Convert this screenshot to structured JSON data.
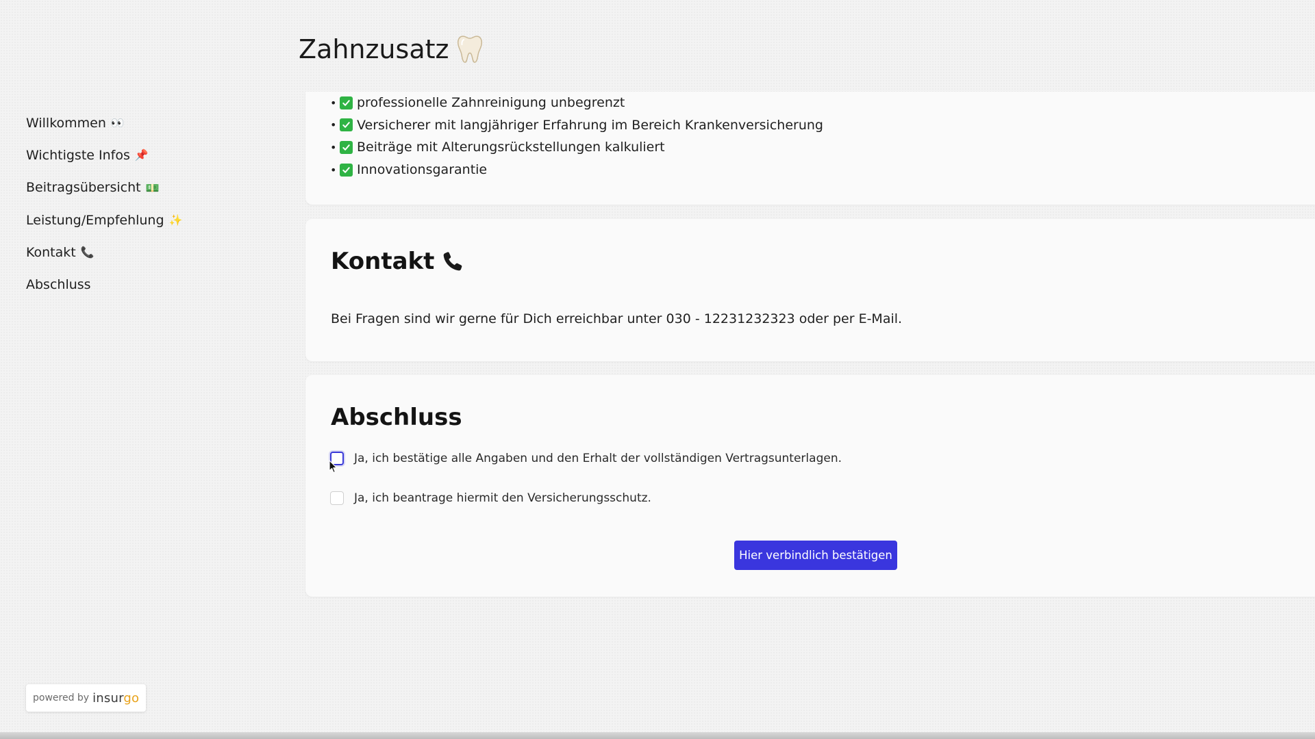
{
  "page_title": "Zahnzusatz",
  "page_title_icon": "tooth-icon",
  "sidebar": {
    "items": [
      {
        "label": "Willkommen",
        "emoji": "👀"
      },
      {
        "label": "Wichtigste Infos",
        "emoji": "📌"
      },
      {
        "label": "Beitragsübersicht",
        "emoji": "💵"
      },
      {
        "label": "Leistung/Empfehlung",
        "emoji": "✨"
      },
      {
        "label": "Kontakt",
        "emoji": "📞"
      },
      {
        "label": "Abschluss",
        "emoji": ""
      }
    ]
  },
  "benefits": {
    "items": [
      "professionelle Zahnreinigung unbegrenzt",
      "Versicherer mit langjähriger Erfahrung im Bereich Krankenversicherung",
      "Beiträge mit Alterungsrückstellungen kalkuliert",
      "Innovationsgarantie"
    ]
  },
  "kontakt": {
    "title": "Kontakt",
    "title_icon": "phone-icon",
    "text": "Bei Fragen sind wir gerne für Dich erreichbar unter 030 - 12231232323 oder per E-Mail."
  },
  "abschluss": {
    "title": "Abschluss",
    "checkbox_1": "Ja, ich bestätige alle Angaben und den Erhalt der vollständigen Vertragsunterlagen.",
    "checkbox_2": "Ja, ich beantrage hiermit den Versicherungsschutz.",
    "checkbox_1_checked": false,
    "checkbox_2_checked": false,
    "button_label": "Hier verbindlich bestätigen"
  },
  "footer": {
    "powered_label": "powered by",
    "brand_main": "insur",
    "brand_accent": "go"
  },
  "colors": {
    "accent": "#3a36de",
    "check_green": "#2fb344",
    "brand_orange": "#e8a21a"
  }
}
